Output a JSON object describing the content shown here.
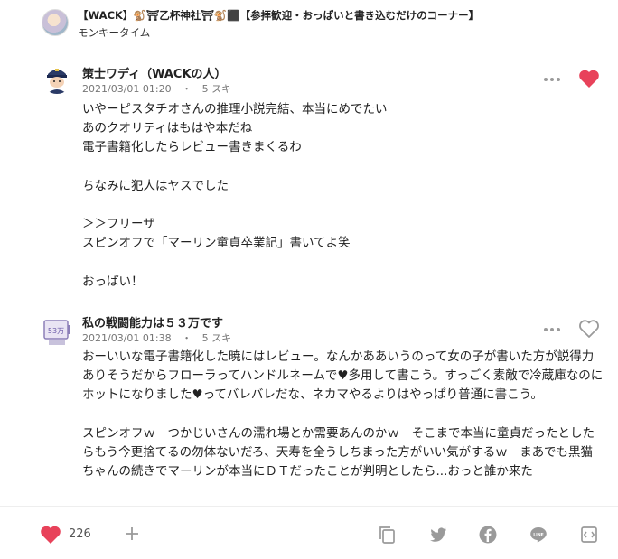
{
  "header": {
    "title": "【WACK】🐒⛩乙杯神社⛩🐒⬛【参拝歓迎・おっぱいと書き込むだけのコーナー】",
    "subtitle": "モンキータイム"
  },
  "comments": [
    {
      "author": "策士ワディ（WACKの人）",
      "timestamp": "2021/03/01 01:20",
      "separator": "・",
      "likes": "5 スキ",
      "liked": true,
      "body": "いやーピスタチオさんの推理小説完結、本当にめでたい\nあのクオリティはもはや本だね\n電子書籍化したらレビュー書きまくるわ\n\nちなみに犯人はヤスでした\n\n＞＞フリーザ\nスピンオフで「マーリン童貞卒業記」書いてよ笑\n\nおっぱい！",
      "avatar_icon": "police-character-avatar-icon"
    },
    {
      "author": "私の戦闘能力は５３万です",
      "timestamp": "2021/03/01 01:38",
      "separator": "・",
      "likes": "5 スキ",
      "liked": false,
      "body": "おーいいな電子書籍化した暁にはレビュー。なんかああいうのって女の子が書いた方が説得力ありそうだからフローラってハンドルネームで♥多用して書こう。すっごく素敵で冷蔵庫なのにホットになりました♥ってバレバレだな、ネカマやるよりはやっぱり普通に書こう。\n\nスピンオフｗ　つかじいさんの濡れ場とか需要あんのかｗ　そこまで本当に童貞だったとしたらもう今更捨てるの勿体ないだろ、天寿を全うしちまった方がいい気がするｗ　まあでも黒猫ちゃんの続きでマーリンが本当にＤＴだったことが判明としたら...おっと誰か来た",
      "avatar_icon": "scouter-display-avatar-icon",
      "avatar_text": "53万"
    }
  ],
  "bottom_bar": {
    "like_count": "226",
    "icons": [
      "heart-icon",
      "plus-icon",
      "copy-icon",
      "twitter-icon",
      "facebook-icon",
      "line-icon",
      "embed-icon"
    ]
  },
  "colors": {
    "like_red": "#e8425a",
    "icon_gray": "#9a9a9a",
    "meta_gray": "#777777"
  }
}
